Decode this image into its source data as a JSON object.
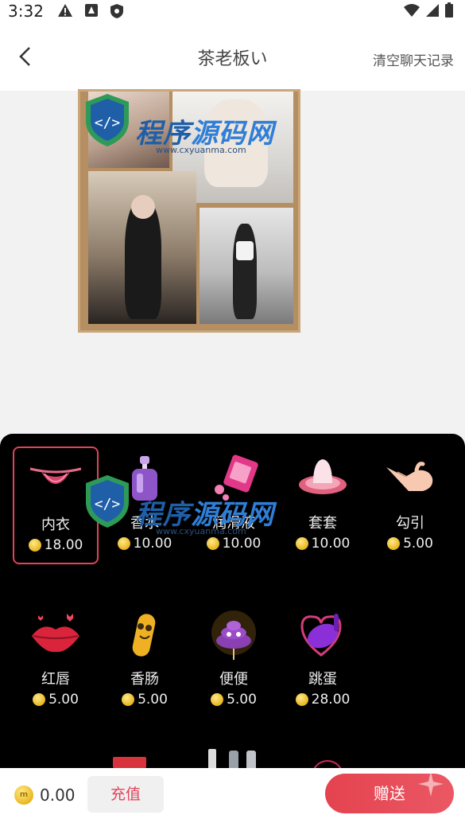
{
  "status": {
    "time": "3:32"
  },
  "header": {
    "title": "茶老板い",
    "clear_label": "清空聊天记录"
  },
  "watermark": {
    "main_a": "程序",
    "main_b": "源码网",
    "url": "www.cxyuanma.com"
  },
  "gifts": [
    {
      "name": "内衣",
      "price": "18.00",
      "icon": "lingerie-icon",
      "selected": true
    },
    {
      "name": "香水",
      "price": "10.00",
      "icon": "perfume-icon"
    },
    {
      "name": "润滑液",
      "price": "10.00",
      "icon": "lubricant-icon"
    },
    {
      "name": "套套",
      "price": "10.00",
      "icon": "condom-icon"
    },
    {
      "name": "勾引",
      "price": "5.00",
      "icon": "beckon-hand-icon"
    },
    {
      "name": "红唇",
      "price": "5.00",
      "icon": "red-lips-icon"
    },
    {
      "name": "香肠",
      "price": "5.00",
      "icon": "sausage-icon"
    },
    {
      "name": "便便",
      "price": "5.00",
      "icon": "poop-icon"
    },
    {
      "name": "跳蛋",
      "price": "28.00",
      "icon": "vibrator-egg-icon"
    }
  ],
  "footer": {
    "balance": "0.00",
    "recharge_label": "充值",
    "send_label": "赠送"
  },
  "colors": {
    "accent": "#e4434f",
    "panel": "#000000",
    "selected_border": "#e0445a"
  }
}
